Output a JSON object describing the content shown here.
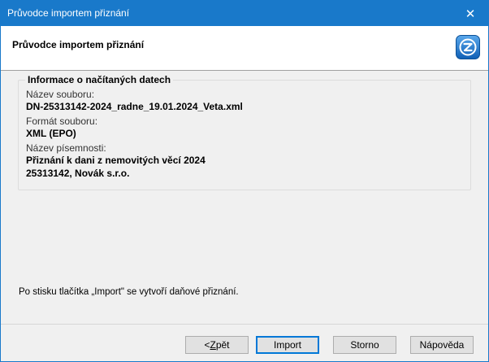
{
  "window": {
    "title": "Průvodce importem přiznání",
    "close_glyph": "✕"
  },
  "header": {
    "title": "Průvodce importem přiznání",
    "logo_icon": "wizard-logo-icon",
    "logo_color": "#1e7bd1"
  },
  "info_group": {
    "legend": "Informace o načítaných datech",
    "file_name_label": "Název souboru:",
    "file_name_value": "DN-25313142-2024_radne_19.01.2024_Veta.xml",
    "file_format_label": "Formát souboru:",
    "file_format_value": "XML (EPO)",
    "document_name_label": "Název písemnosti:",
    "document_name_value": "Přiznání k dani z nemovitých věcí 2024",
    "company_value": "25313142, Novák s.r.o."
  },
  "info_text": "Po stisku tlačítka „Import\" se vytvoří daňové přiznání.",
  "buttons": {
    "back_prefix": "< ",
    "back_hotkey": "Z",
    "back_rest": "pět",
    "import": "Import",
    "cancel": "Storno",
    "help": "Nápověda"
  }
}
